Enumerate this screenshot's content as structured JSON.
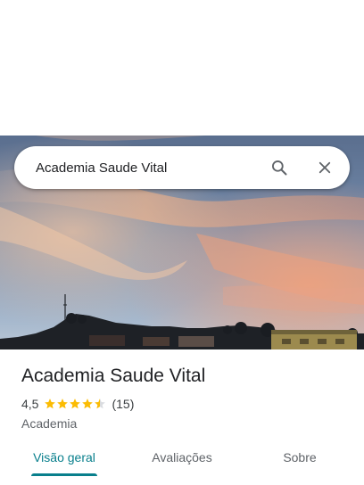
{
  "search": {
    "query": "Academia Saude Vital"
  },
  "place": {
    "title": "Academia Saude Vital",
    "rating": "4,5",
    "rating_value": 4.5,
    "review_count": "(15)",
    "category": "Academia"
  },
  "tabs": [
    {
      "label": "Visão geral",
      "active": true
    },
    {
      "label": "Avaliações",
      "active": false
    },
    {
      "label": "Sobre",
      "active": false
    }
  ],
  "icons": {
    "search": "search-icon",
    "close": "close-icon",
    "star": "star-icon"
  },
  "colors": {
    "accent": "#087f8c",
    "star": "#fbbc04",
    "star_empty": "#dadce0"
  }
}
